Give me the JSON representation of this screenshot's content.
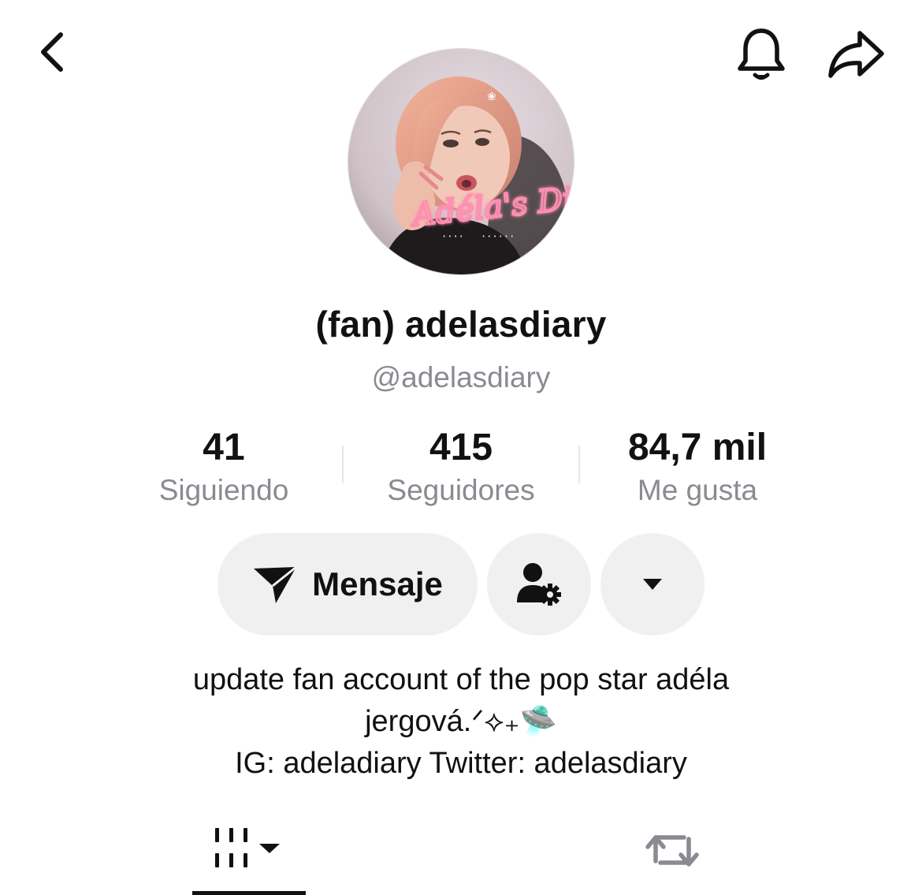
{
  "profile": {
    "display_name": "(fan) adelasdiary",
    "handle": "@adelasdiary",
    "avatar_text": "Adéla's Diary"
  },
  "stats": [
    {
      "value": "41",
      "label": "Siguiendo"
    },
    {
      "value": "415",
      "label": "Seguidores"
    },
    {
      "value": "84,7 mil",
      "label": "Me gusta"
    }
  ],
  "actions": {
    "message_label": "Mensaje"
  },
  "bio": {
    "line1": "update fan account of the pop star adéla",
    "line2": "jergová.ᐟ⟡₊🛸",
    "line3": "IG: adeladiary Twitter: adelasdiary"
  },
  "icons": {
    "back": "chevron-left-icon",
    "notifications": "bell-icon",
    "share": "share-arrow-icon",
    "message": "paper-plane-icon",
    "follow_settings": "person-gear-icon",
    "more": "caret-down-icon",
    "videos_tab": "grid-icon",
    "reposts_tab": "repost-icon"
  },
  "colors": {
    "text_primary": "#111111",
    "text_secondary": "#8a8b91",
    "button_bg": "#f0f0f0",
    "avatar_accent": "#ff8fb0"
  }
}
